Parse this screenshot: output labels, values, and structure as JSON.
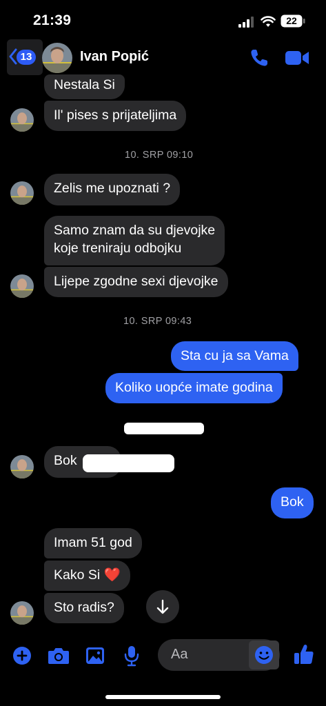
{
  "status_bar": {
    "time": "21:39",
    "battery": "22"
  },
  "header": {
    "unread_count": "13",
    "contact_name": "Ivan Popić"
  },
  "messages": {
    "m1": "Nestala Si",
    "m2": "Il' pises s prijateljima",
    "ts1": "10. SRP 09:10",
    "m3": "Zelis me upoznati ?",
    "m4a": "Samo znam da su djevojke",
    "m4b": "koje treniraju odbojku",
    "m5": "Lijepe zgodne sexi djevojke",
    "ts2": "10. SRP 09:43",
    "m6": "Sta cu ja sa Vama",
    "m7": "Koliko uopće imate godina",
    "m8": "Bok",
    "m9": "Bok",
    "m10": "Imam 51 god",
    "m11": "Kako Si ❤️",
    "m12": "Sto radis?"
  },
  "composer": {
    "placeholder": "Aa"
  },
  "colors": {
    "accent": "#2e62f2",
    "incoming_bubble": "#2a2a2c",
    "background": "#000000"
  }
}
